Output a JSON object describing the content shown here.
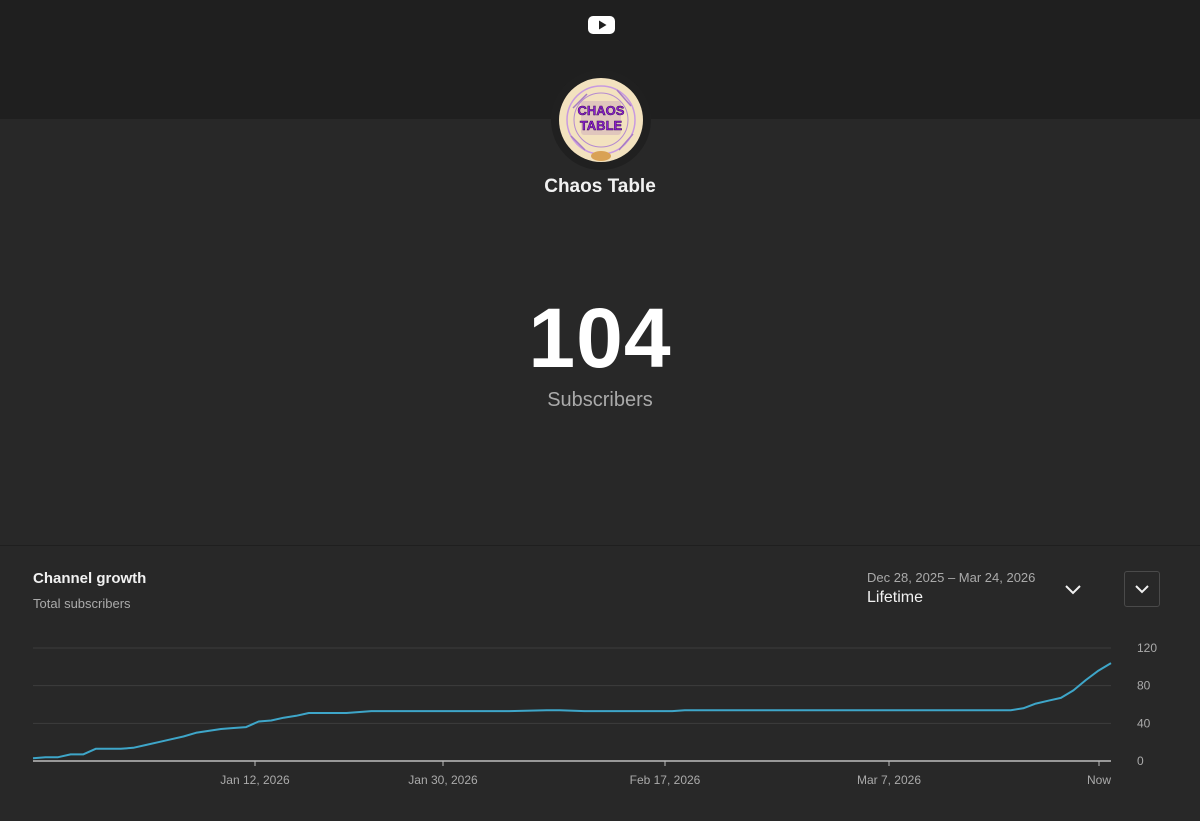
{
  "header": {
    "logo_icon": "youtube-logo-icon"
  },
  "channel": {
    "name": "Chaos Table",
    "avatar_text_line1": "CHAOS",
    "avatar_text_line2": "TABLE"
  },
  "subscribers": {
    "count": "104",
    "label": "Subscribers"
  },
  "growth_card": {
    "title": "Channel growth",
    "subtitle": "Total subscribers",
    "date_range": "Dec 28, 2025 – Mar 24, 2026",
    "range_label": "Lifetime",
    "range_dropdown_icon": "chevron-down-icon",
    "more_button_icon": "chevron-down-icon"
  },
  "colors": {
    "line": "#3ea6c9",
    "background": "#282828",
    "header": "#1f1f1f",
    "grid": "#3d3d3d",
    "axis": "#bdbdbd",
    "label": "#aaaaaa"
  },
  "chart_data": {
    "type": "line",
    "title": "Channel growth",
    "subtitle": "Total subscribers",
    "x_tick_labels": [
      "Jan 12, 2026",
      "Jan 30, 2026",
      "Feb 17, 2026",
      "Mar 7, 2026",
      "Now"
    ],
    "y_ticks": [
      0,
      40,
      80,
      120
    ],
    "ylim": [
      0,
      120
    ],
    "xlim": [
      "2025-12-28",
      "2026-03-24"
    ],
    "y_axis_side": "right",
    "grid": true,
    "series": [
      {
        "x": [
          "2025-12-28",
          "2025-12-29",
          "2025-12-30",
          "2025-12-31",
          "2026-01-01",
          "2026-01-02",
          "2026-01-03",
          "2026-01-04",
          "2026-01-05",
          "2026-01-06",
          "2026-01-07",
          "2026-01-08",
          "2026-01-09",
          "2026-01-10",
          "2026-01-11",
          "2026-01-12",
          "2026-01-13",
          "2026-01-14",
          "2026-01-15",
          "2026-01-16",
          "2026-01-17",
          "2026-01-18",
          "2026-01-19",
          "2026-01-20",
          "2026-01-22",
          "2026-01-24",
          "2026-01-26",
          "2026-01-29",
          "2026-02-01",
          "2026-02-04",
          "2026-02-07",
          "2026-02-08",
          "2026-02-10",
          "2026-02-11",
          "2026-02-14",
          "2026-02-17",
          "2026-02-18",
          "2026-02-22",
          "2026-03-01",
          "2026-03-08",
          "2026-03-14",
          "2026-03-16",
          "2026-03-17",
          "2026-03-18",
          "2026-03-19",
          "2026-03-20",
          "2026-03-21",
          "2026-03-22",
          "2026-03-23",
          "2026-03-24"
        ],
        "y": [
          3,
          4,
          4,
          7,
          7,
          13,
          13,
          13,
          14,
          17,
          20,
          23,
          26,
          30,
          32,
          34,
          35,
          36,
          42,
          43,
          46,
          48,
          51,
          51,
          51,
          53,
          53,
          53,
          53,
          53,
          54,
          54,
          53,
          53,
          53,
          53,
          54,
          54,
          54,
          54,
          54,
          54,
          56,
          61,
          64,
          67,
          75,
          86,
          96,
          104
        ]
      }
    ]
  }
}
